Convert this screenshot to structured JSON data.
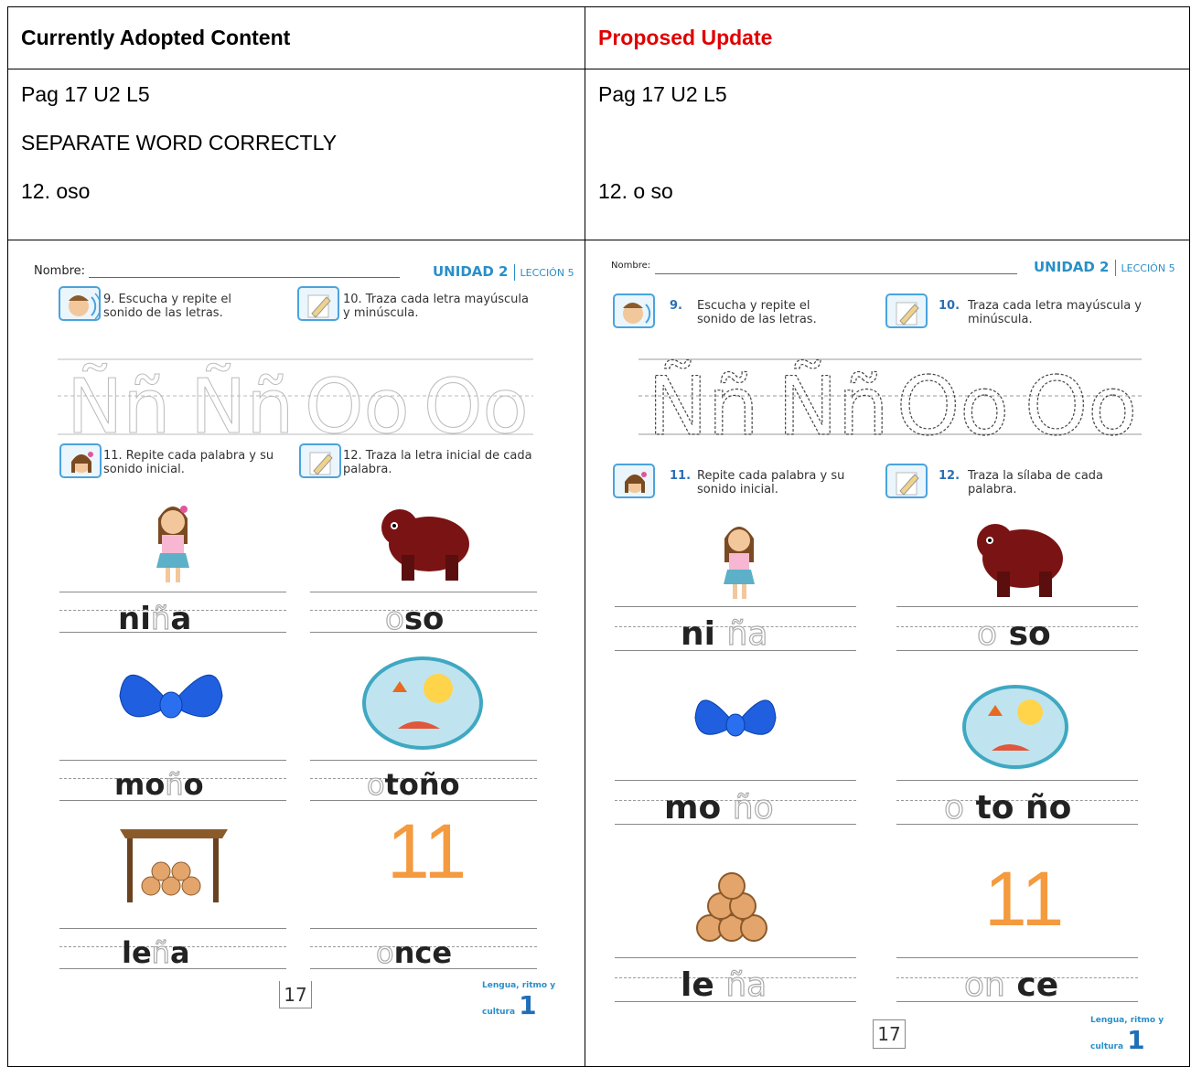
{
  "table": {
    "col_left_header": "Currently Adopted Content",
    "col_right_header": "Proposed Update",
    "header_right_color": "#e00000",
    "left_lines": [
      "Pag 17 U2 L5",
      "SEPARATE WORD CORRECTLY",
      "12.  oso"
    ],
    "right_lines": [
      "Pag 17 U2 L5",
      "",
      "12.  o   so"
    ]
  },
  "current_page": {
    "nombre": "Nombre:",
    "unidad": "UNIDAD 2",
    "leccion": "LECCIÓN 5",
    "instr9": "9. Escucha y repite el sonido de las letras.",
    "instr10": "10. Traza cada letra mayúscula y minúscula.",
    "instr11": "11. Repite cada palabra y su sonido inicial.",
    "instr12": "12. Traza la letra inicial de cada palabra.",
    "trace_letters": [
      "Ññ",
      "Ññ",
      "Oo",
      "Oo"
    ],
    "words": [
      {
        "solid": "ni",
        "ghost": "ñ",
        "after": "a"
      },
      {
        "solid": "",
        "ghost": "o",
        "after": "so"
      },
      {
        "solid": "mo",
        "ghost": "ñ",
        "after": "o"
      },
      {
        "solid": "",
        "ghost": "o",
        "after": "toño"
      },
      {
        "solid": "le",
        "ghost": "ñ",
        "after": "a"
      },
      {
        "solid": "",
        "ghost": "o",
        "after": "nce"
      }
    ],
    "number_image": "11",
    "page_number": "17",
    "logo_text": "Lengua, ritmo y cultura",
    "logo_num": "1"
  },
  "proposed_page": {
    "nombre": "Nombre:",
    "unidad": "UNIDAD 2",
    "leccion": "LECCIÓN 5",
    "instr9_num": "9.",
    "instr9": "Escucha y repite el sonido de las letras.",
    "instr10_num": "10.",
    "instr10": "Traza cada letra mayúscula y minúscula.",
    "instr11_num": "11.",
    "instr11": "Repite cada palabra y su sonido inicial.",
    "instr12_num": "12.",
    "instr12": "Traza la sílaba de cada palabra.",
    "trace_letters": [
      "Ññ",
      "Ññ",
      "Oo",
      "Oo"
    ],
    "words": [
      {
        "solid": "ni",
        "ghost": "ña",
        "after": ""
      },
      {
        "solid": "",
        "ghost": "o",
        "after": "so"
      },
      {
        "solid": "mo",
        "ghost": "ño",
        "after": ""
      },
      {
        "solid": "",
        "ghost": "o",
        "after": "to ño"
      },
      {
        "solid": "le",
        "ghost": "ña",
        "after": ""
      },
      {
        "solid": "",
        "ghost": "on",
        "after": "ce"
      }
    ],
    "number_image": "11",
    "page_number": "17",
    "logo_text": "Lengua, ritmo y cultura",
    "logo_num": "1"
  }
}
